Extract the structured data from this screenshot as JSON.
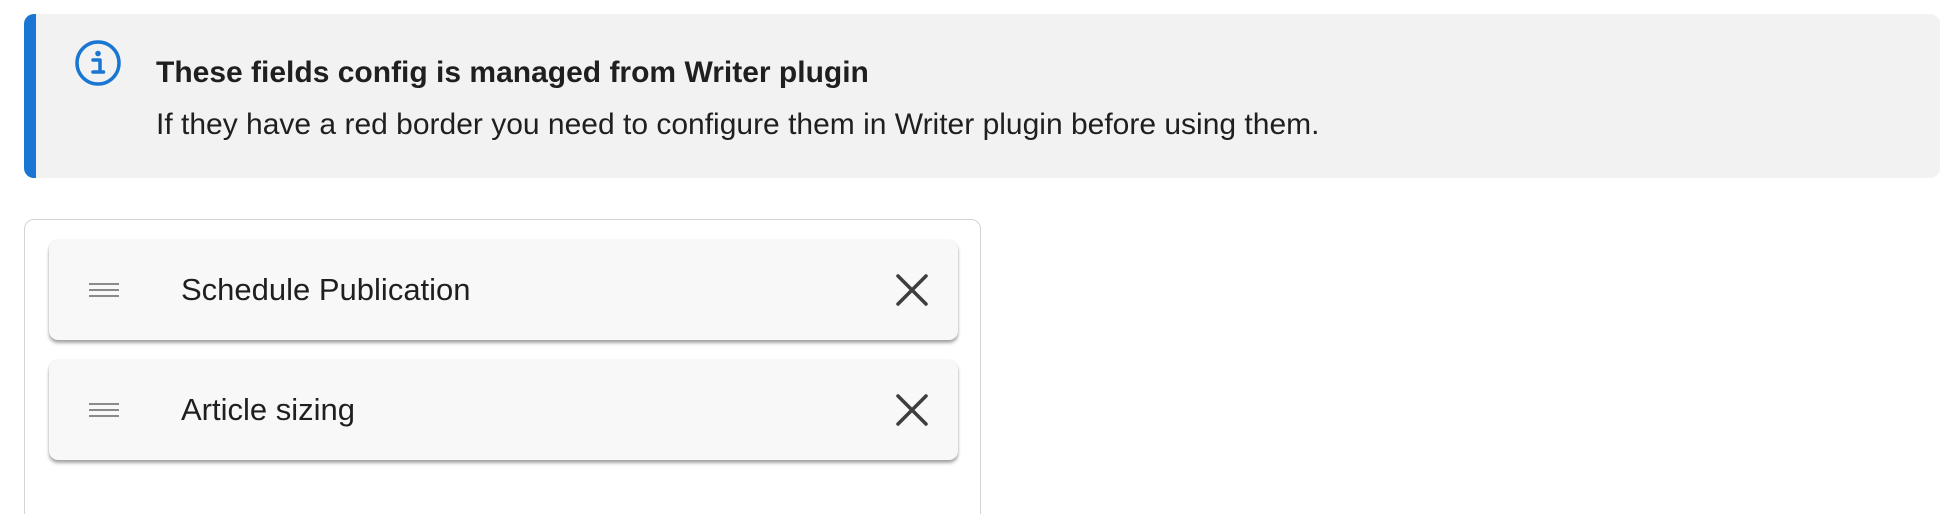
{
  "info_banner": {
    "icon": "info-circle-icon",
    "accent_color": "#1976d2",
    "title": "These fields config is managed from Writer plugin",
    "body": "If they have a red border you need to configure them in Writer plugin before using them."
  },
  "fields": {
    "items": [
      {
        "label": "Schedule Publication",
        "drag_icon": "drag-handle-icon",
        "remove_icon": "close-icon"
      },
      {
        "label": "Article sizing",
        "drag_icon": "drag-handle-icon",
        "remove_icon": "close-icon"
      }
    ]
  }
}
